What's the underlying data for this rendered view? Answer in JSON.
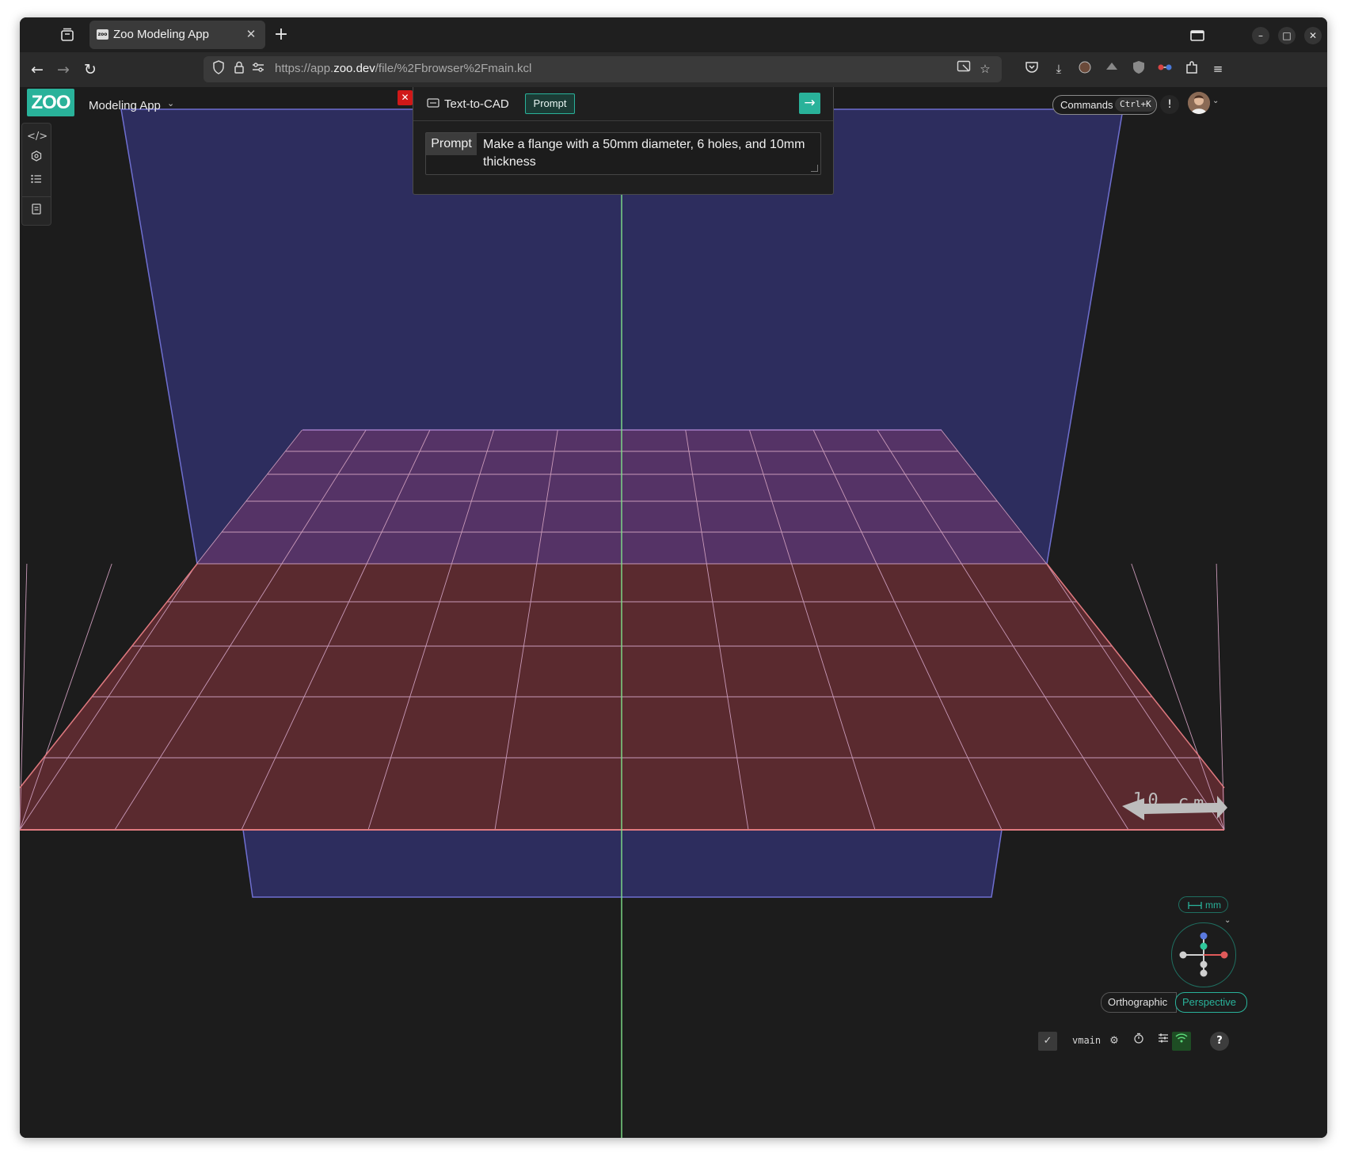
{
  "browser": {
    "tab_title": "Zoo Modeling App",
    "favicon_text": "zoo",
    "url_prefix": "https://app.",
    "url_domain": "zoo.dev",
    "url_path": "/file/%2Fbrowser%2Fmain.kcl"
  },
  "app": {
    "logo_text": "ZOO",
    "name": "Modeling App"
  },
  "text_to_cad": {
    "title": "Text-to-CAD",
    "chip": "Prompt",
    "field_label": "Prompt",
    "prompt_value": "Make a flange with a 50mm diameter, 6 holes, and 10mm thickness"
  },
  "commands": {
    "label": "Commands",
    "shortcut": "Ctrl+K"
  },
  "scene": {
    "scale_label": "10 cm",
    "units": "mm",
    "projection": {
      "orthographic": "Orthographic",
      "perspective": "Perspective",
      "active": "Perspective"
    }
  },
  "status_bar": {
    "branch": "vmain"
  },
  "colors": {
    "accent": "#29b29a",
    "xy_plane": "#5a2a2f",
    "xz_plane": "#2d2d5e",
    "far_grid": "#553366"
  }
}
